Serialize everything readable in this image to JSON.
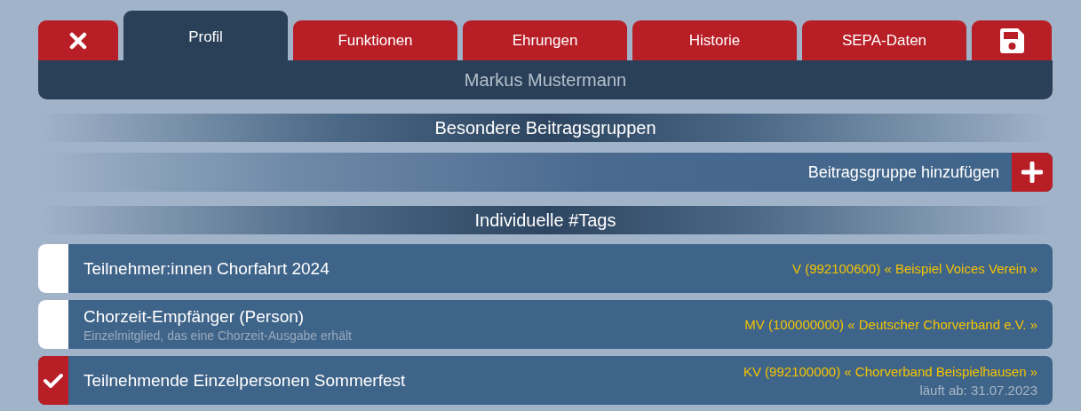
{
  "tabs": [
    {
      "label": "Profil",
      "selected": true
    },
    {
      "label": "Funktionen",
      "selected": false
    },
    {
      "label": "Ehrungen",
      "selected": false
    },
    {
      "label": "Historie",
      "selected": false
    },
    {
      "label": "SEPA-Daten",
      "selected": false
    }
  ],
  "person_name": "Markus Mustermann",
  "special_groups": {
    "heading": "Besondere Beitragsgruppen",
    "add_label": "Beitragsgruppe hinzufügen"
  },
  "tags": {
    "heading": "Individuelle #Tags",
    "items": [
      {
        "title": "Teilnehmer:innen Chorfahrt 2024",
        "checked": false,
        "organization": "V (992100600) « Beispiel Voices Verein »"
      },
      {
        "title": "Chorzeit-Empfänger (Person)",
        "subtitle": "Einzelmitglied, das eine Chorzeit-Ausgabe erhält",
        "checked": false,
        "organization": "MV (100000000) « Deutscher Chorverband e.V. »"
      },
      {
        "title": "Teilnehmende Einzelpersonen Sommerfest",
        "checked": true,
        "organization": "KV (992100000) « Chorverband Beispielhausen »",
        "expires": "läuft ab: 31.07.2023"
      }
    ]
  }
}
